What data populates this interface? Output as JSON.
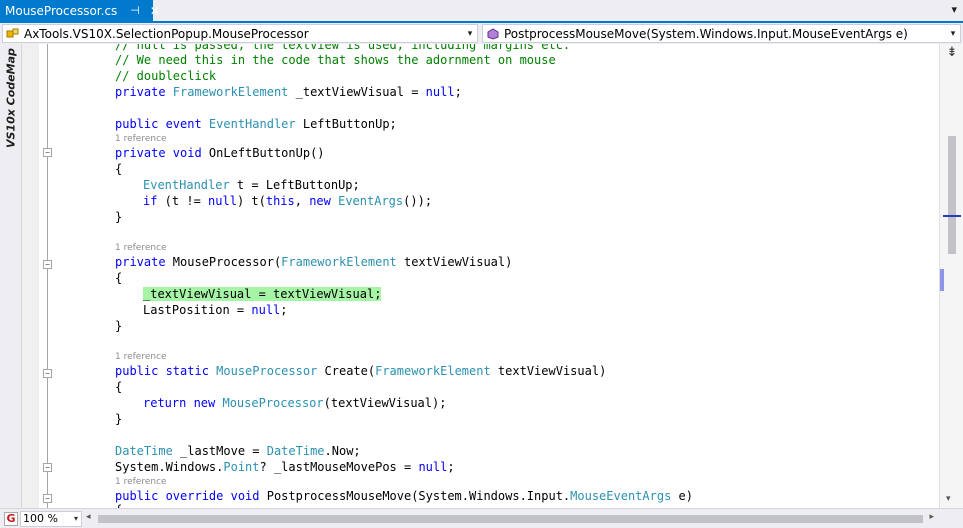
{
  "tab": {
    "title": "MouseProcessor.cs",
    "pin": "⊣",
    "close": "✕"
  },
  "tab_overflow": "▾",
  "nav": {
    "class_combo": "AxTools.VS10X.SelectionPopup.MouseProcessor",
    "member_combo": "PostprocessMouseMove(System.Windows.Input.MouseEventArgs e)",
    "arrow": "▾"
  },
  "codemap": {
    "label": "VS10x CodeMap"
  },
  "code": {
    "l0": "// null is passed, the textview is used, including margins etc.",
    "l1": "// We need this in the code that shows the adornment on mouse",
    "l2": "// doubleclick",
    "l3": {
      "kw": "private ",
      "ty": "FrameworkElement",
      "rest": " _textViewVisual = ",
      "kw2": "null",
      "end": ";"
    },
    "l4": {
      "kw": "public event ",
      "ty": "EventHandler",
      "rest": " LeftButtonUp;"
    },
    "lens1": "1 reference",
    "l5": {
      "kw": "private void ",
      "rest": "OnLeftButtonUp()"
    },
    "l6": "{",
    "l7": {
      "ty": "EventHandler",
      "rest": " t = LeftButtonUp;"
    },
    "l8": {
      "kw": "if",
      "a": " (t != ",
      "kw2": "null",
      "b": ") t(",
      "kw3": "this",
      "c": ", ",
      "kw4": "new ",
      "ty": "EventArgs",
      "d": "());"
    },
    "l9": "}",
    "lens2": "1 reference",
    "l10": {
      "kw": "private ",
      "rest": "MouseProcessor(",
      "ty": "FrameworkElement",
      "end": " textViewVisual)"
    },
    "l11": "{",
    "l12": "_textViewVisual = textViewVisual;",
    "l13": {
      "rest": "LastPosition = ",
      "kw": "null",
      "end": ";"
    },
    "l14": "}",
    "lens3": "1 reference",
    "l15": {
      "kw": "public static ",
      "ty": "MouseProcessor",
      "rest": " Create(",
      "ty2": "FrameworkElement",
      "end": " textViewVisual)"
    },
    "l16": "{",
    "l17": {
      "kw": "return new ",
      "ty": "MouseProcessor",
      "rest": "(textViewVisual);"
    },
    "l18": "}",
    "l19": {
      "ty": "DateTime",
      "rest": " _lastMove = ",
      "ty2": "DateTime",
      "end": ".Now;"
    },
    "l20": {
      "a": "System.Windows.",
      "ty": "Point",
      "b": "? _lastMouseMovePos = ",
      "kw": "null",
      "c": ";"
    },
    "lens4": "1 reference",
    "l21": {
      "kw": "public override void ",
      "rest": "PostprocessMouseMove(System.Windows.Input.",
      "ty": "MouseEventArgs",
      "end": " e)"
    },
    "l22": "{"
  },
  "bottom": {
    "g_label": "G",
    "zoom": "100 %",
    "zoom_arrow": "▾",
    "left_arrow": "◂",
    "right_arrow": "▸"
  },
  "scroll": {
    "split": "⇟",
    "down_arrow": "▾"
  },
  "colors": {
    "accent": "#007acc",
    "keyword": "#0000ff",
    "type": "#2b91af",
    "comment": "#008000",
    "highlight": "#a6f5a6"
  },
  "icons": {
    "class_icon": "class-icon",
    "method_icon": "method-icon"
  }
}
